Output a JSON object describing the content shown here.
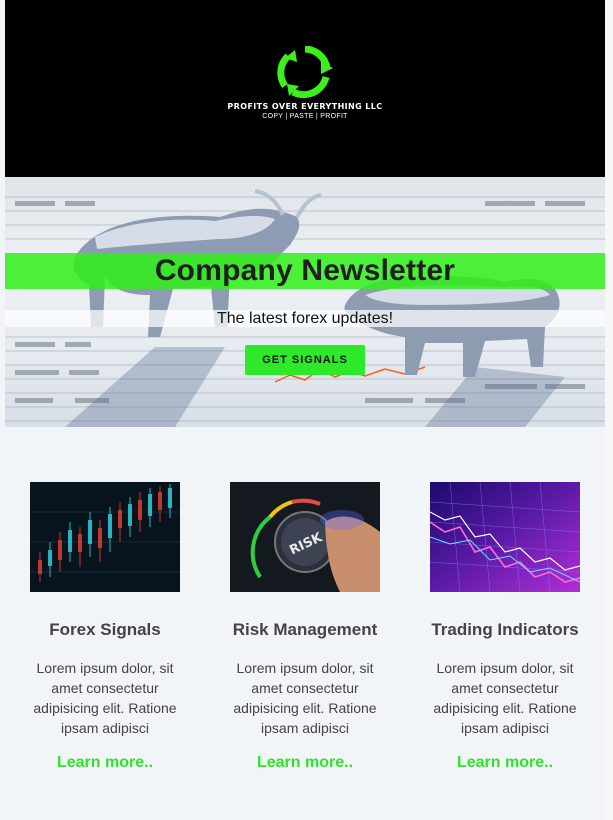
{
  "header": {
    "logo_icon": "recycle-dollar-logo-icon",
    "brand_name": "PROFITS OVER EVERYTHING LLC",
    "brand_tagline": "COPY | PASTE | PROFIT"
  },
  "hero": {
    "background": "bull-and-bear-on-stock-tables-image",
    "title": "Company Newsletter",
    "subtitle": "The latest forex updates!",
    "cta_label": "GET SIGNALS"
  },
  "features": [
    {
      "image": "candlestick-chart-image",
      "title": "Forex Signals",
      "body": "Lorem ipsum dolor, sit amet consectetur adipisicing elit. Ratione ipsam adipisci",
      "link": "Learn more.."
    },
    {
      "image": "risk-knob-image",
      "title": "Risk Management",
      "body": "Lorem ipsum dolor, sit amet consectetur adipisicing elit. Ratione ipsam adipisci",
      "link": "Learn more.."
    },
    {
      "image": "trading-indicators-chart-image",
      "title": "Trading Indicators",
      "body": "Lorem ipsum dolor, sit amet consectetur adipisicing elit. Ratione ipsam adipisci",
      "link": "Learn more.."
    }
  ],
  "colors": {
    "accent_green": "#2ee82a",
    "header_bg": "#000000",
    "page_bg": "#f1f5f8",
    "text_gray": "#444444"
  }
}
